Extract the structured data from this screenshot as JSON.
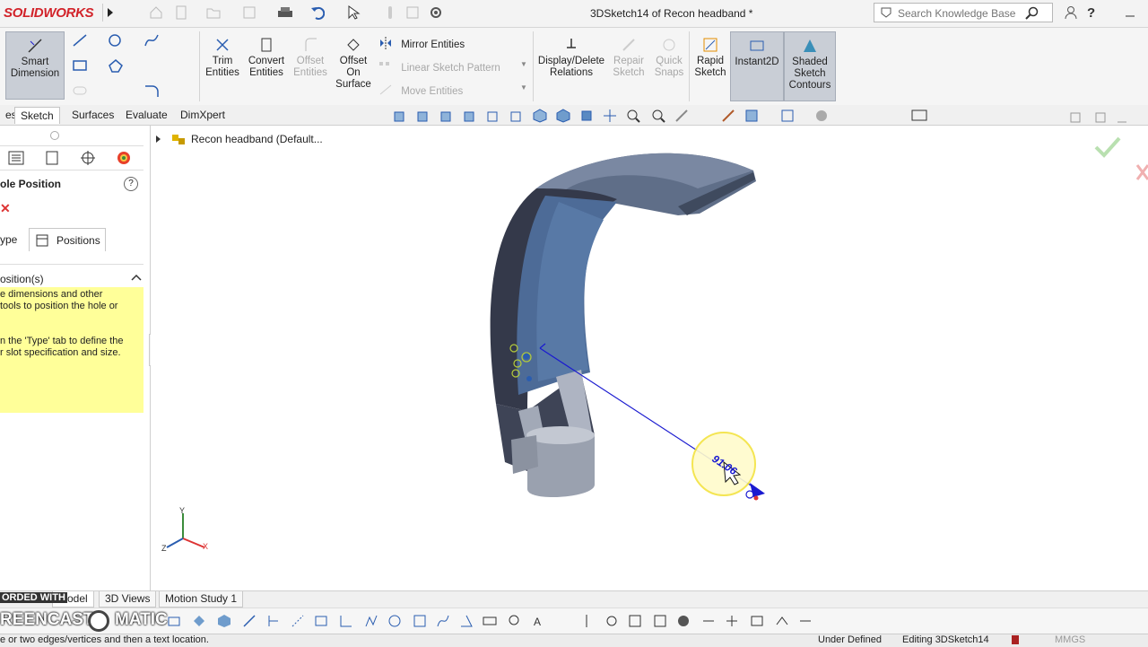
{
  "app": {
    "logo_text": "SOLIDWORKS",
    "document_title": "3DSketch14 of Recon headband *"
  },
  "search": {
    "placeholder": "Search Knowledge Base"
  },
  "command_manager": {
    "smart_dimension": [
      "Smart",
      "Dimension"
    ],
    "trim_entities": [
      "Trim",
      "Entities"
    ],
    "convert_entities": [
      "Convert",
      "Entities"
    ],
    "offset_entities": [
      "Offset",
      "Entities"
    ],
    "offset_on_surface": [
      "Offset",
      "On",
      "Surface"
    ],
    "mirror_entities": "Mirror Entities",
    "linear_sketch_pattern": "Linear Sketch Pattern",
    "move_entities": "Move Entities",
    "display_delete_relations": [
      "Display/Delete",
      "Relations"
    ],
    "repair_sketch": [
      "Repair",
      "Sketch"
    ],
    "quick_snaps": [
      "Quick",
      "Snaps"
    ],
    "rapid_sketch": [
      "Rapid",
      "Sketch"
    ],
    "instant2d": "Instant2D",
    "shaded_sketch_contours": [
      "Shaded",
      "Sketch",
      "Contours"
    ]
  },
  "tabs": [
    "es",
    "Sketch",
    "Surfaces",
    "Evaluate",
    "DimXpert"
  ],
  "active_tab": "Sketch",
  "property_manager": {
    "title": "ole Position",
    "subtab_type": "ype",
    "subtab_positions": "Positions",
    "section_title": "osition(s)",
    "hint_lines": [
      "e dimensions and other",
      " tools to position the hole or",
      "",
      "",
      "n the 'Type' tab to define the",
      "r slot specification and size."
    ]
  },
  "feature_tree": {
    "root_label": "Recon headband  (Default..."
  },
  "dimension": {
    "value": "91.06"
  },
  "axes": {
    "x": "X",
    "y": "Y",
    "z": "Z"
  },
  "bottom_tabs": [
    "Model",
    "3D Views",
    "Motion Study 1"
  ],
  "screencast": {
    "line1": "ORDED WITH",
    "line2": "REENCAST",
    "line3": "MATIC"
  },
  "status": {
    "left": "e or two edges/vertices and then a text location.",
    "under_defined": "Under Defined",
    "editing": "Editing 3DSketch14",
    "units": "MMGS"
  },
  "colors": {
    "brand_red": "#d2232a",
    "hint_yellow": "#ffff99",
    "dimension_blue": "#1a1ad0",
    "part_blue": "#5d6f8c"
  }
}
